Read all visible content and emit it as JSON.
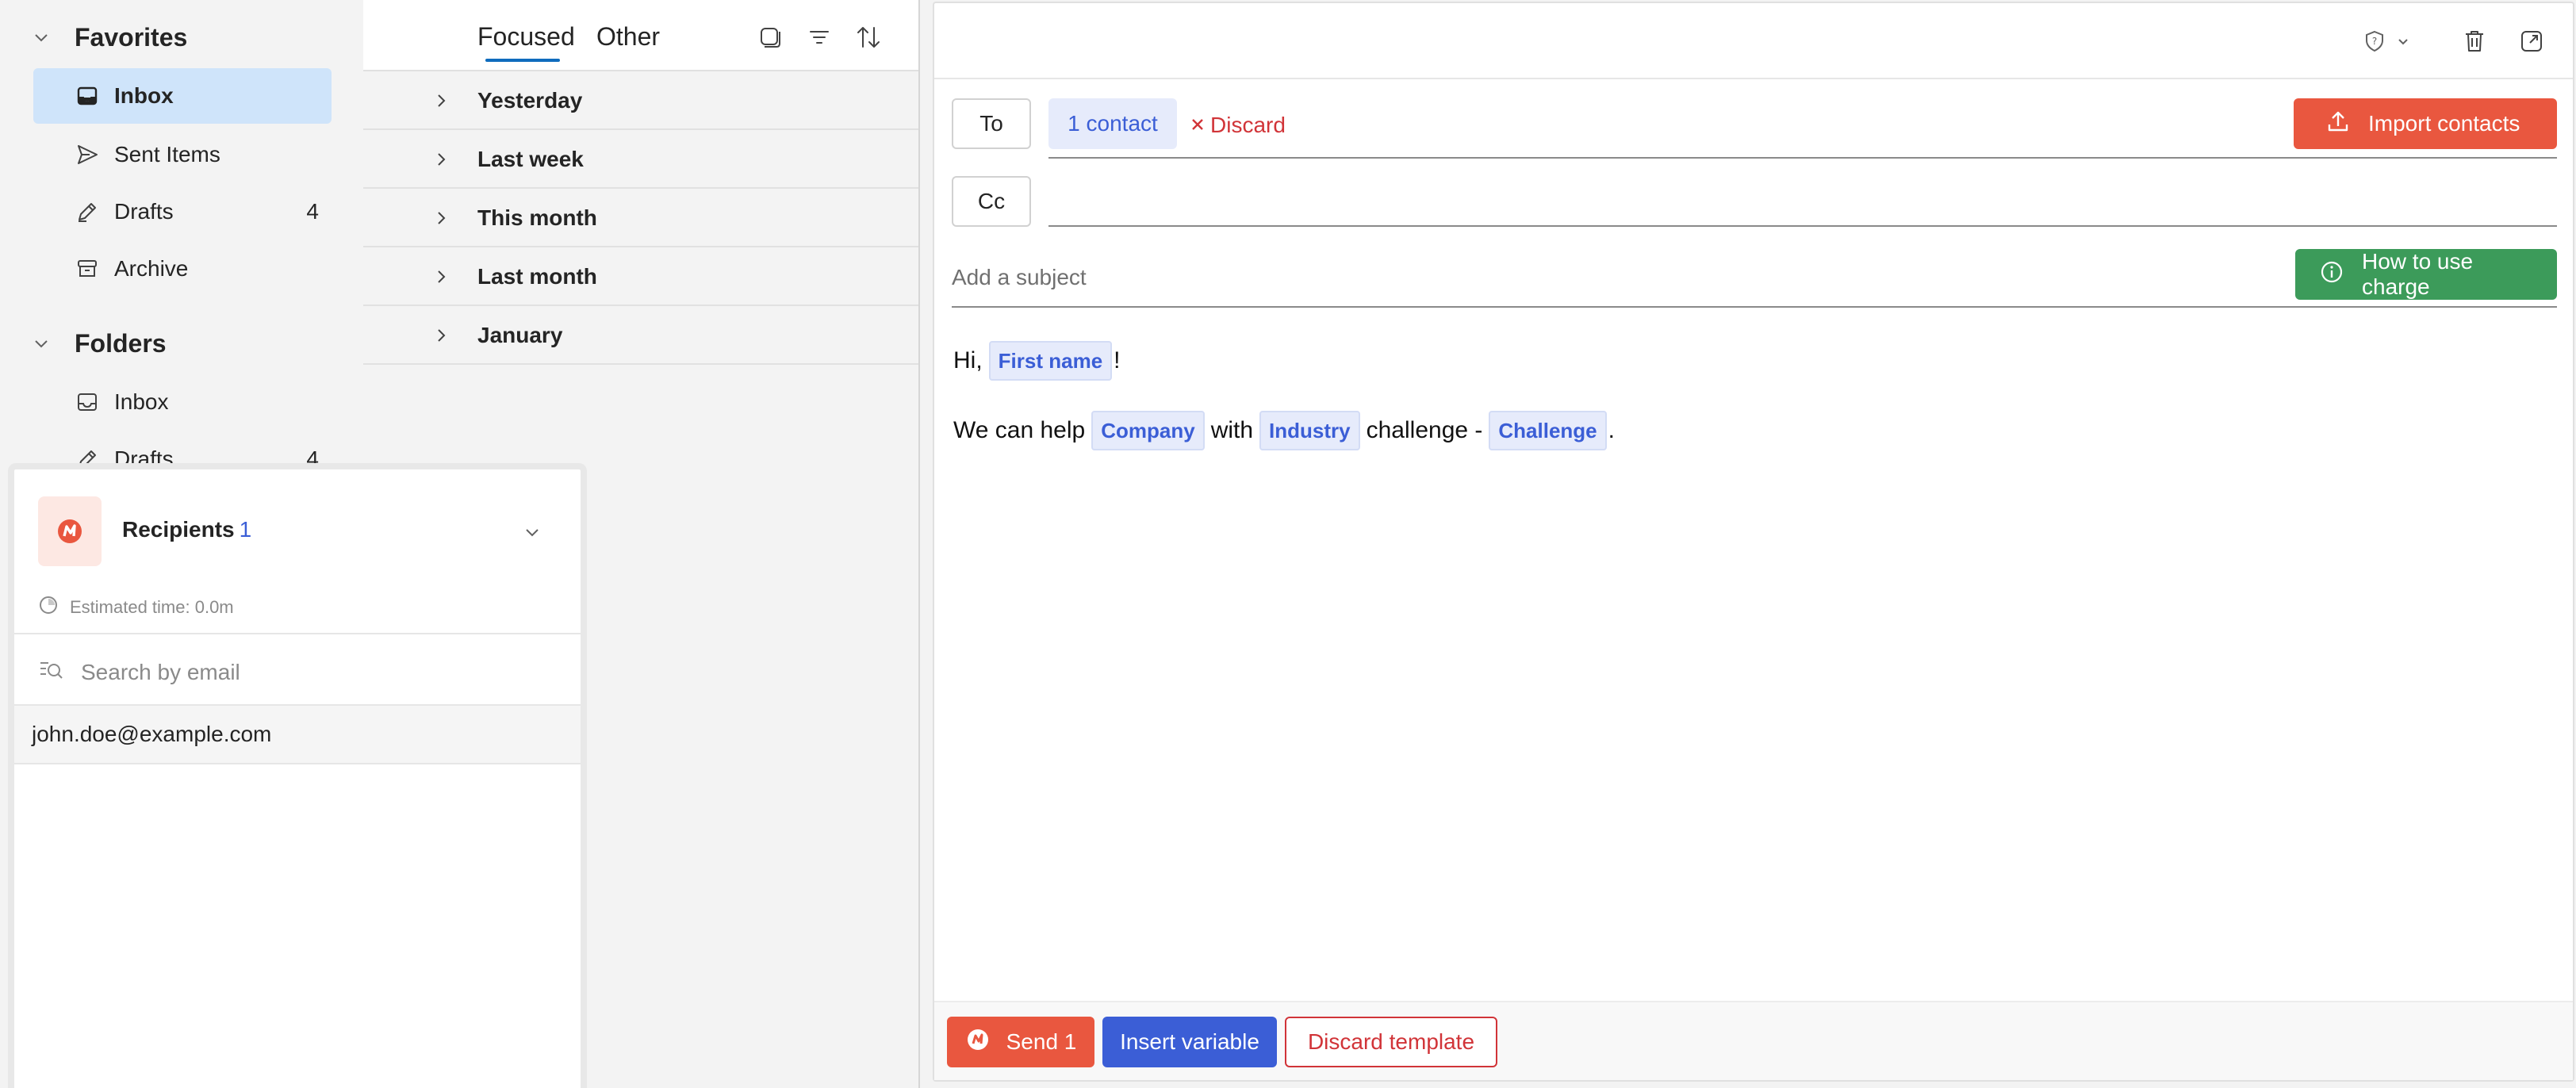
{
  "nav": {
    "favorites_label": "Favorites",
    "favorites": [
      {
        "label": "Inbox",
        "icon": "inbox-icon",
        "count": ""
      },
      {
        "label": "Sent Items",
        "icon": "send-icon",
        "count": ""
      },
      {
        "label": "Drafts",
        "icon": "pencil-icon",
        "count": "4"
      },
      {
        "label": "Archive",
        "icon": "archive-icon",
        "count": ""
      }
    ],
    "folders_label": "Folders",
    "folders": [
      {
        "label": "Inbox",
        "icon": "inbox-icon",
        "count": ""
      },
      {
        "label": "Drafts",
        "icon": "pencil-icon",
        "count": "4"
      }
    ]
  },
  "list": {
    "tabs": [
      "Focused",
      "Other"
    ],
    "groups": [
      "Yesterday",
      "Last week",
      "This month",
      "Last month",
      "January"
    ]
  },
  "compose": {
    "to_label": "To",
    "contact_chip": "1 contact",
    "discard_label": "Discard",
    "import_label": "Import contacts",
    "cc_label": "Cc",
    "subject_placeholder": "Add a subject",
    "howto_label": "How to use charge",
    "body": {
      "greeting_prefix": "Hi,",
      "first_name_var": "First name",
      "greeting_suffix": "!",
      "line2_a": "We can help",
      "company_var": "Company",
      "line2_b": "with",
      "industry_var": "Industry",
      "line2_c": "challenge -",
      "challenge_var": "Challenge",
      "line2_end": "."
    },
    "send_label": "Send 1",
    "insert_label": "Insert variable",
    "discard_template_label": "Discard template"
  },
  "recipients": {
    "title": "Recipients",
    "count": "1",
    "estimated": "Estimated time: 0.0m",
    "search_placeholder": "Search by email",
    "emails": [
      "john.doe@example.com"
    ]
  },
  "colors": {
    "accent_blue": "#0f6cbd",
    "brand_orange": "#e9573f",
    "brand_green": "#3c9b5a",
    "variable_blue": "#3b5ed6",
    "danger_red": "#d13438",
    "selected_bg": "#cfe4fa"
  }
}
